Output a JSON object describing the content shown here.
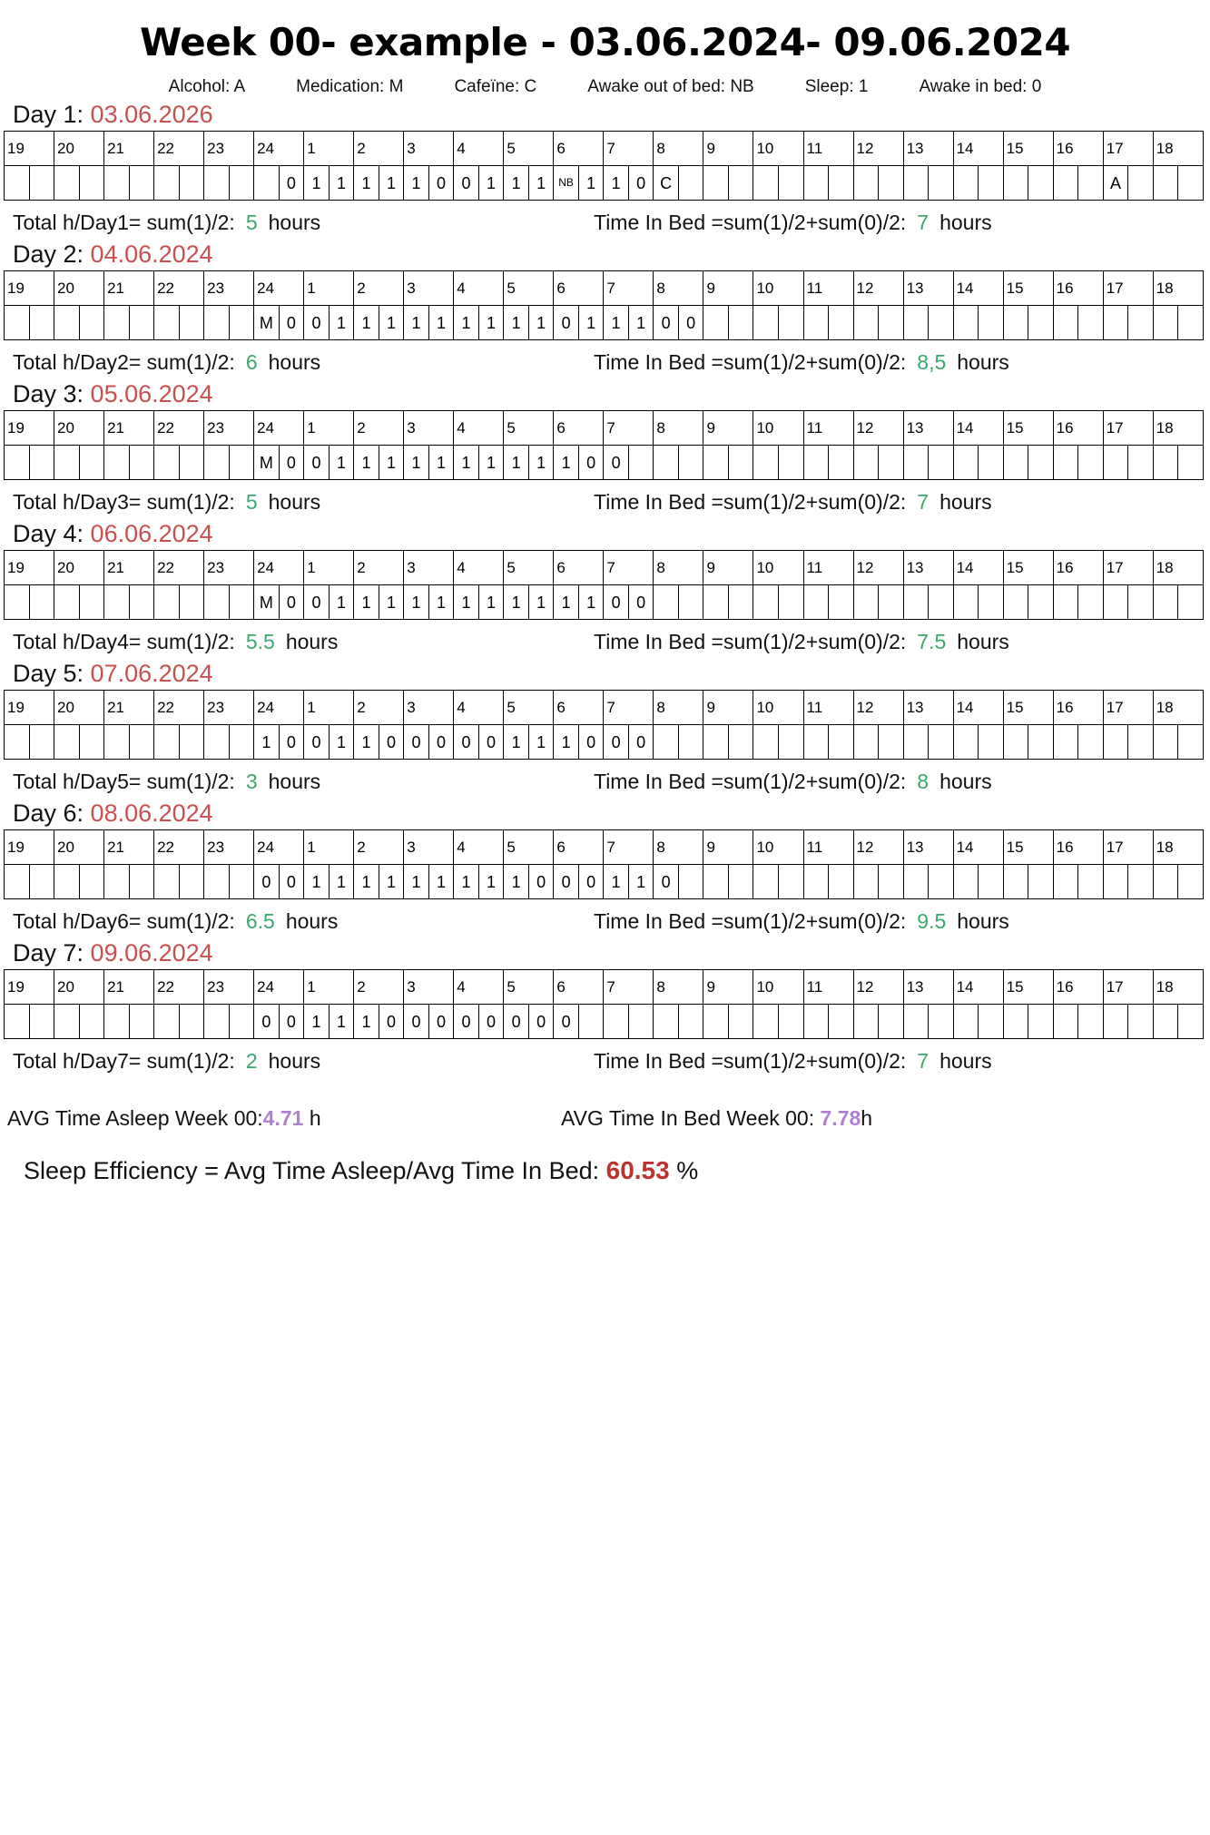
{
  "title": "Week 00- example - 03.06.2024- 09.06.2024",
  "legend": [
    "Alcohol: A",
    "Medication: M",
    "Cafeïne: C",
    "Awake out of bed: NB",
    "Sleep: 1",
    "Awake in bed: 0"
  ],
  "hour_headers": [
    "19",
    "20",
    "21",
    "22",
    "23",
    "24",
    "1",
    "2",
    "3",
    "4",
    "5",
    "6",
    "7",
    "8",
    "9",
    "10",
    "11",
    "12",
    "13",
    "14",
    "15",
    "16",
    "17",
    "18"
  ],
  "labels": {
    "total_prefix": "Total h/Day",
    "total_suffix": "= sum(1)/2:",
    "hours_word": "hours",
    "tib_label": "Time In Bed =sum(1)/2+sum(0)/2:",
    "avg_asleep_label": "AVG Time Asleep Week 00:",
    "avg_asleep_unit": " h",
    "avg_bed_label": "AVG Time In Bed Week 00: ",
    "avg_bed_unit": "h",
    "efficiency_label": "Sleep Efficiency = Avg Time Asleep/Avg Time In Bed: ",
    "efficiency_unit": " %"
  },
  "days": [
    {
      "n": "1",
      "label": "Day 1: ",
      "date": "03.06.2026",
      "start": 11,
      "cells": [
        "0",
        "1",
        "1",
        "1",
        "1",
        "1",
        "0",
        "0",
        "1",
        "1",
        "1",
        "NB",
        "1",
        "1",
        "0",
        "C"
      ],
      "extra": [
        {
          "index": 44,
          "value": "A"
        }
      ],
      "total": "5",
      "time_in_bed": "7"
    },
    {
      "n": "2",
      "label": "Day 2: ",
      "date": "04.06.2024",
      "start": 10,
      "cells": [
        "M",
        "0",
        "0",
        "1",
        "1",
        "1",
        "1",
        "1",
        "1",
        "1",
        "1",
        "1",
        "0",
        "1",
        "1",
        "1",
        "0",
        "0"
      ],
      "extra": [],
      "total": "6",
      "time_in_bed": "8,5"
    },
    {
      "n": "3",
      "label": "Day 3: ",
      "date": "05.06.2024",
      "start": 10,
      "cells": [
        "M",
        "0",
        "0",
        "1",
        "1",
        "1",
        "1",
        "1",
        "1",
        "1",
        "1",
        "1",
        "1",
        "0",
        "0"
      ],
      "extra": [],
      "total": "5",
      "time_in_bed": "7"
    },
    {
      "n": "4",
      "label": "Day 4: ",
      "date": "06.06.2024",
      "start": 10,
      "cells": [
        "M",
        "0",
        "0",
        "1",
        "1",
        "1",
        "1",
        "1",
        "1",
        "1",
        "1",
        "1",
        "1",
        "1",
        "0",
        "0"
      ],
      "extra": [],
      "total": "5.5",
      "time_in_bed": "7.5"
    },
    {
      "n": "5",
      "label": "Day 5: ",
      "date": "07.06.2024",
      "start": 10,
      "cells": [
        "1",
        "0",
        "0",
        "1",
        "1",
        "0",
        "0",
        "0",
        "0",
        "0",
        "1",
        "1",
        "1",
        "0",
        "0",
        "0"
      ],
      "extra": [],
      "total": "3",
      "time_in_bed": "8"
    },
    {
      "n": "6",
      "label": "Day 6: ",
      "date": "08.06.2024",
      "start": 10,
      "cells": [
        "0",
        "0",
        "1",
        "1",
        "1",
        "1",
        "1",
        "1",
        "1",
        "1",
        "1",
        "0",
        "0",
        "0",
        "1",
        "1",
        "0"
      ],
      "extra": [],
      "total": "6.5",
      "time_in_bed": "9.5"
    },
    {
      "n": "7",
      "label": "Day 7: ",
      "date": "09.06.2024",
      "start": 10,
      "cells": [
        "0",
        "0",
        "1",
        "1",
        "1",
        "0",
        "0",
        "0",
        "0",
        "0",
        "0",
        "0",
        "0"
      ],
      "extra": [],
      "total": "2",
      "time_in_bed": "7"
    }
  ],
  "summary": {
    "avg_asleep": "4.71",
    "avg_bed": "7.78",
    "efficiency": "60.53"
  },
  "colors": {
    "date": "#c9504f",
    "green": "#3aa86b",
    "purple": "#b07fd0",
    "red": "#b8342c"
  }
}
